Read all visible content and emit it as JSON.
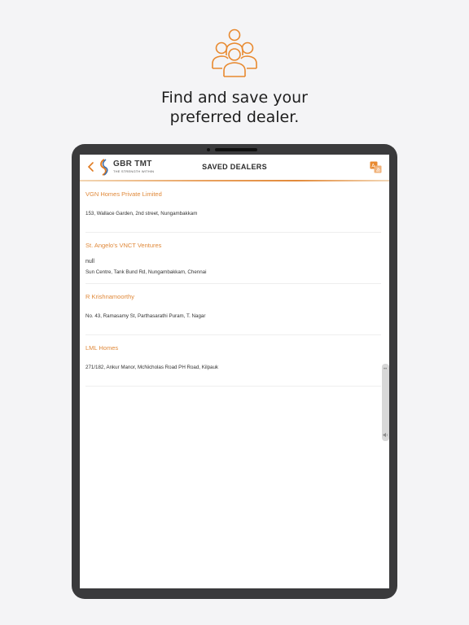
{
  "promo": {
    "headline_line1": "Find and save your",
    "headline_line2": "preferred dealer.",
    "icon": "people-group-icon",
    "accent_color": "#e8892f"
  },
  "app": {
    "logo_title": "GBR TMT",
    "logo_tagline": "THE STRENGTH WITHIN",
    "header_title": "SAVED DEALERS",
    "back_icon": "chevron-left-icon",
    "share_icon": "translate-icon",
    "accent_color": "#e07b22"
  },
  "dealers": [
    {
      "name": "VGN Homes Private Limited",
      "extra": "",
      "address": "153, Wallace Garden, 2nd street, Nungambakkam"
    },
    {
      "name": "St. Angelo's VNCT Ventures",
      "extra": "null",
      "address": "Sun Centre, Tank Bund Rd, Nungambakkam, Chennai"
    },
    {
      "name": "R Krishnamoorthy",
      "extra": "",
      "address": "No. 43, Ramasamy St, Parthasarathi Puram, T. Nagar"
    },
    {
      "name": "LML Homes",
      "extra": "",
      "address": "271/182, Ankur Manor, McNicholas Road PH Road, Kilpauk"
    }
  ]
}
